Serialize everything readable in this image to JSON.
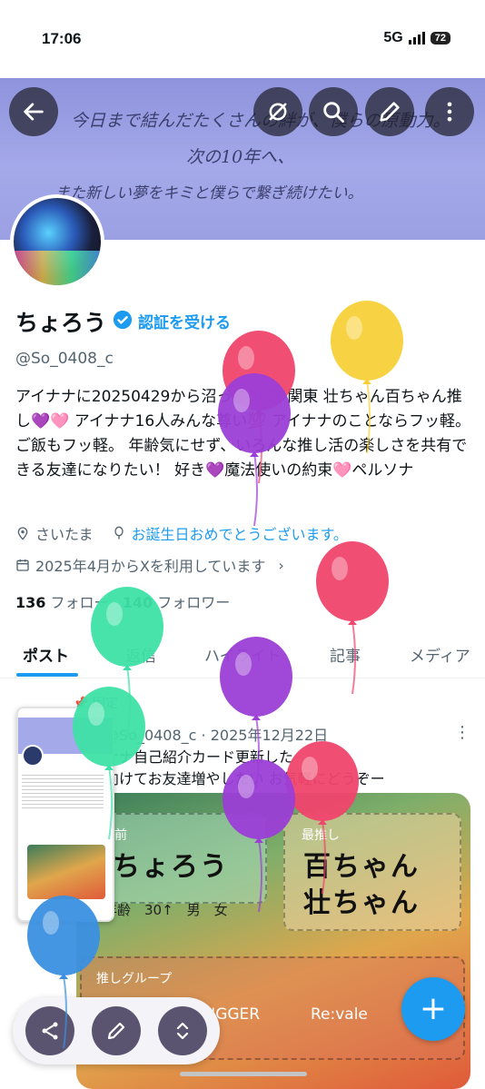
{
  "status_bar": {
    "time": "17:06",
    "network": "5G",
    "battery": "72"
  },
  "banner": {
    "lines": [
      "今日まで結んだたくさんの絆が、僕らの原動力。",
      "次の10年へ、",
      "また新しい夢をキミと僕らで繋ぎ続けたい。"
    ]
  },
  "header_icons": [
    "back-arrow-icon",
    "grok-icon",
    "search-icon",
    "edit-icon",
    "more-icon"
  ],
  "profile": {
    "name": "ちょろう",
    "verify_label": "認証を受ける",
    "handle": "@So_0408_c",
    "bio": "アイナナに20250429から沼った35歳 関東 壮ちゃん百ちゃん推し💜🩷 アイナナ16人みんな尊い💯 アイナナのことならフッ軽。ご飯もフッ軽。 年齢気にせず、いろんな推し活の楽しさを共有できる友達になりたい！ 好き💜魔法使いの約束🩷ペルソナ",
    "location": "さいたま",
    "birthday": "お誕生日おめでとうございます。",
    "joined": "2025年4月からXを利用しています",
    "following_count": "136",
    "following_label": "フォロー",
    "followers_count": "140",
    "followers_label": "フォロワー"
  },
  "tabs": [
    "ポスト",
    "返信",
    "ハイライト",
    "記事",
    "メディア"
  ],
  "pinned_post": {
    "pinned_label": "固定",
    "author": "ちょろう",
    "handle_date": "@So_0408_c · 2025年12月22日",
    "text_line1": "ナナ自己紹介カード更新した",
    "text_line2": "向けてお友達増やしたい お気軽にどうぞー",
    "card": {
      "name_label": "名前",
      "name_value": "ちょろう",
      "age_line": "年齢　30↑　男　女",
      "oshi_label": "最推し",
      "oshi_line1": "百ちゃん",
      "oshi_line2": "壮ちゃん",
      "group_label": "推しグループ",
      "group_1": "TRIGGER",
      "group_2": "Re:vale"
    }
  },
  "fab_label": "+",
  "bottom_toolbar": [
    "share-icon",
    "edit-pencil-icon",
    "expand-icon"
  ],
  "balloon_colors": [
    "#f7d13a",
    "#f0456d",
    "#9b3ed6",
    "#3ee0a7",
    "#3a8fe0"
  ]
}
